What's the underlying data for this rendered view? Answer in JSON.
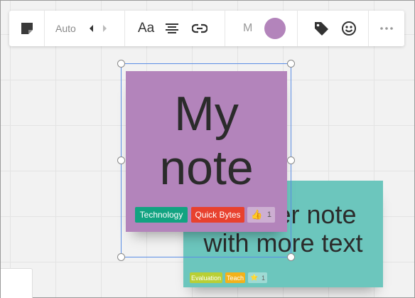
{
  "toolbar": {
    "size_mode": "Auto",
    "font_label": "Aa",
    "size_label": "M",
    "note_color": "#b384bb"
  },
  "notes": {
    "main": {
      "text_line1": "My",
      "text_line2": "note",
      "color": "#b384bb",
      "tags": [
        {
          "label": "Technology",
          "color": "#12a381"
        },
        {
          "label": "Quick Bytes",
          "color": "#e8412e"
        }
      ],
      "reaction": {
        "emoji": "👍",
        "count": "1"
      }
    },
    "back": {
      "text_line1": "Another note",
      "text_line2": "with more text",
      "color": "#6cc6bd",
      "tags": [
        {
          "label": "Evaluation",
          "color": "#b8cf35"
        },
        {
          "label": "Teach",
          "color": "#f3b21a"
        }
      ],
      "reaction": {
        "emoji": "⭐",
        "count": "1"
      }
    }
  }
}
